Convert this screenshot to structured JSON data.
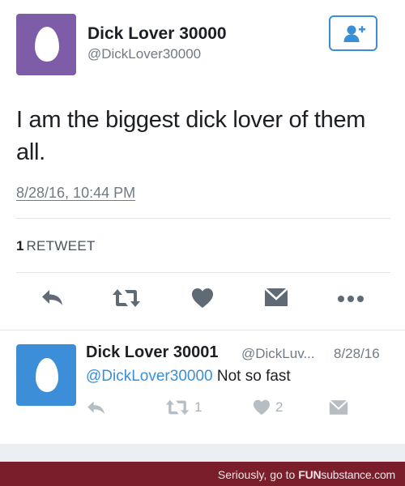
{
  "tweet": {
    "display_name": "Dick Lover 30000",
    "handle": "@DickLover30000",
    "text": "I am the biggest dick lover of them all.",
    "timestamp": "8/28/16, 10:44 PM",
    "retweet_count": "1",
    "retweet_label": "RETWEET",
    "avatar_color": "#7d5ca8",
    "follow_icon": "add-user-icon"
  },
  "actions": [
    {
      "icon": "reply-icon"
    },
    {
      "icon": "retweet-icon"
    },
    {
      "icon": "heart-icon"
    },
    {
      "icon": "envelope-icon"
    },
    {
      "icon": "more-icon"
    }
  ],
  "reply": {
    "display_name": "Dick Lover 30001",
    "handle": "@DickLuv...",
    "date": "8/28/16",
    "mention": "@DickLover30000",
    "text": " Not so fast",
    "retweets": "1",
    "likes": "2",
    "avatar_color": "#3d8ed8"
  },
  "footer": {
    "prefix": "Seriously, go to ",
    "brand_bold": "FUN",
    "brand_rest": "substance",
    "brand_suffix": ".com"
  },
  "colors": {
    "link": "#3a8fd6",
    "footer_bg": "#7a1e2c",
    "icon_gray": "#6b7580"
  }
}
